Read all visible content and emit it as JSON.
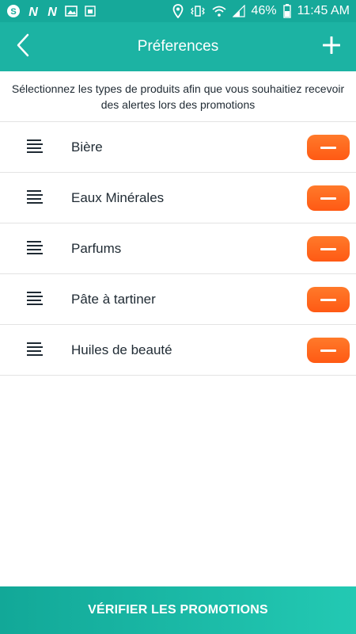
{
  "status_bar": {
    "battery": "46%",
    "time": "11:45 AM",
    "left_icons": [
      "skype-icon",
      "n-icon",
      "n-icon",
      "image-icon",
      "android-icon"
    ],
    "right_icons": [
      "location-icon",
      "vibrate-icon",
      "wifi-icon",
      "signal-icon",
      "battery-icon"
    ]
  },
  "header": {
    "title": "Préferences",
    "back_icon": "chevron-left-icon",
    "add_icon": "plus-icon"
  },
  "description": "Sélectionnez les types de produits afin que vous souhaitiez recevoir des alertes lors des promotions",
  "preferences": [
    {
      "label": "Bière"
    },
    {
      "label": "Eaux Minérales"
    },
    {
      "label": "Parfums"
    },
    {
      "label": "Pâte à tartiner"
    },
    {
      "label": "Huiles de beauté"
    }
  ],
  "footer": {
    "button_label": "VÉRIFIER LES PROMOTIONS"
  },
  "colors": {
    "header": "#1cb3a3",
    "status_bar": "#16a99a",
    "remove_button": "#ff6a1f",
    "footer_start": "#12a898",
    "footer_end": "#23c9b3"
  }
}
